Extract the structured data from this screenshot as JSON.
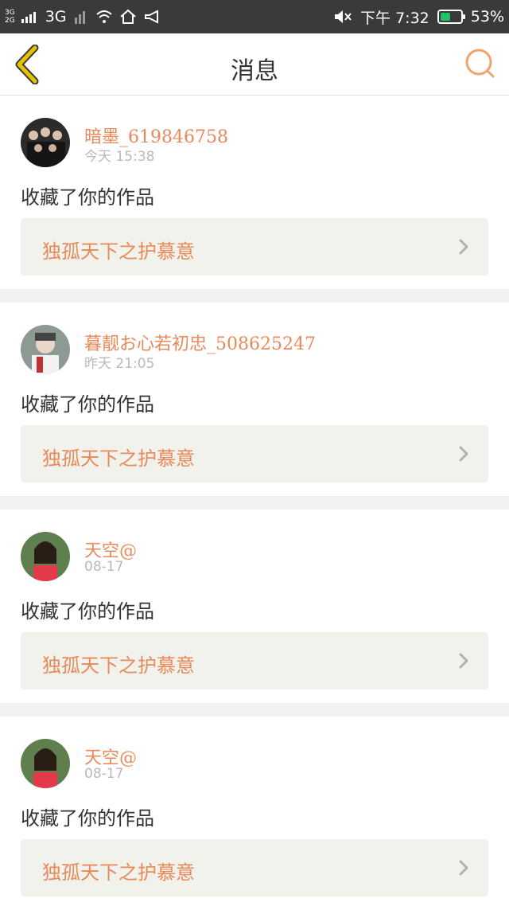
{
  "status_bar": {
    "net_top": "3G",
    "net_bottom": "2G",
    "network": "3G",
    "time": "下午 7:32",
    "battery": "53%",
    "battery_level": 0.53,
    "battery_color": "#1fc16b"
  },
  "header": {
    "title": "消息",
    "back_icon": "chevron-left-icon",
    "search_icon": "search-icon",
    "accent": "#e6c300"
  },
  "messages": [
    {
      "user": "暗墨_619846758",
      "time": "今天 15:38",
      "action": "收藏了你的作品",
      "work": "独孤天下之护慕意"
    },
    {
      "user": "暮靓お心若初忠_508625247",
      "time": "昨天 21:05",
      "action": "收藏了你的作品",
      "work": "独孤天下之护慕意"
    },
    {
      "user": "天空@",
      "time": "08-17",
      "action": "收藏了你的作品",
      "work": "独孤天下之护慕意"
    },
    {
      "user": "天空@",
      "time": "08-17",
      "action": "收藏了你的作品",
      "work": "独孤天下之护慕意"
    }
  ]
}
